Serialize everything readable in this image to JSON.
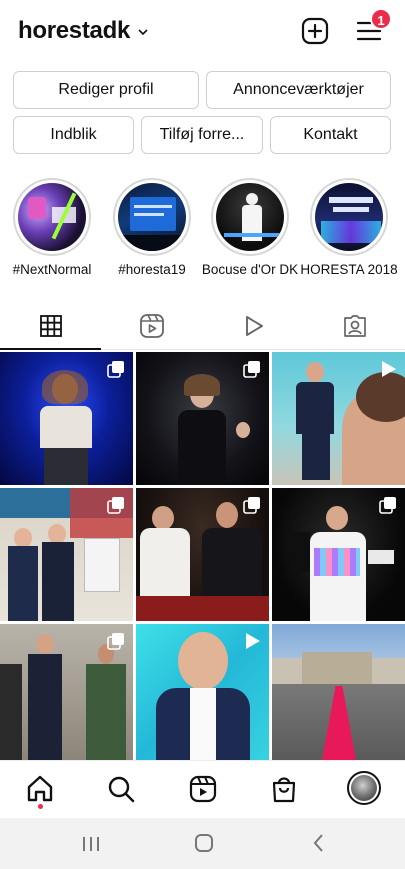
{
  "header": {
    "username": "horestadk",
    "notification_count": "1"
  },
  "profile_buttons": {
    "edit_profile": "Rediger profil",
    "ad_tools": "Annonceværktøjer",
    "insights": "Indblik",
    "add_shop": "Tilføj forre...",
    "contact": "Kontakt"
  },
  "highlights": [
    {
      "label": "#NextNormal"
    },
    {
      "label": "#horesta19"
    },
    {
      "label": "Bocuse d'Or DK"
    },
    {
      "label": "HORESTA 2018"
    }
  ],
  "tabs": [
    {
      "name": "posts-grid",
      "icon": "grid-icon",
      "active": true
    },
    {
      "name": "reels",
      "icon": "reels-icon"
    },
    {
      "name": "videos",
      "icon": "play-icon"
    },
    {
      "name": "tagged",
      "icon": "tagged-person-icon"
    }
  ],
  "grid_posts": [
    {
      "badge": "carousel-icon"
    },
    {
      "badge": "carousel-icon"
    },
    {
      "badge": "play-icon"
    },
    {
      "badge": "carousel-icon"
    },
    {
      "badge": "carousel-icon"
    },
    {
      "badge": "carousel-icon"
    },
    {
      "badge": "carousel-icon"
    },
    {
      "badge": "play-icon"
    },
    {
      "badge": ""
    }
  ],
  "bottom_nav": [
    {
      "name": "home",
      "icon": "home-icon",
      "active": true
    },
    {
      "name": "search",
      "icon": "search-icon"
    },
    {
      "name": "reels",
      "icon": "reels-icon"
    },
    {
      "name": "shop",
      "icon": "shopping-bag-icon"
    },
    {
      "name": "profile",
      "icon": "avatar"
    }
  ],
  "system_nav": [
    {
      "icon": "recent-apps-icon"
    },
    {
      "icon": "home-button-icon"
    },
    {
      "icon": "back-icon"
    }
  ],
  "colors": {
    "accent": "#e92d4a",
    "border": "#cfcfcf",
    "text": "#111111"
  }
}
